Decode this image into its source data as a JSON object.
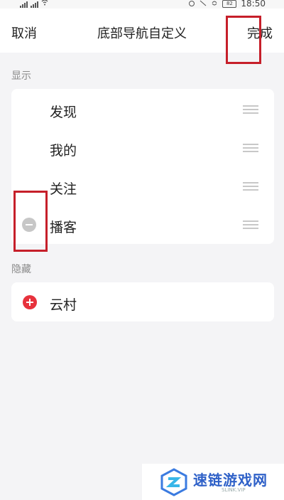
{
  "status_bar": {
    "time": "18:50",
    "battery": "82",
    "network_left": "4G",
    "network_right": "4G"
  },
  "header": {
    "cancel_label": "取消",
    "title": "底部导航自定义",
    "done_label": "完成"
  },
  "sections": {
    "shown_label": "显示",
    "hidden_label": "隐藏"
  },
  "shown_items": [
    {
      "label": "发现"
    },
    {
      "label": "我的"
    },
    {
      "label": "关注"
    },
    {
      "label": "播客"
    }
  ],
  "hidden_items": [
    {
      "label": "云村"
    }
  ],
  "colors": {
    "highlight_box": "#c61f2a",
    "add_icon": "#e7323d",
    "remove_icon": "#c7c7c7"
  },
  "watermark": {
    "text": "速链游戏网",
    "sub": "SLINK.VIP"
  }
}
